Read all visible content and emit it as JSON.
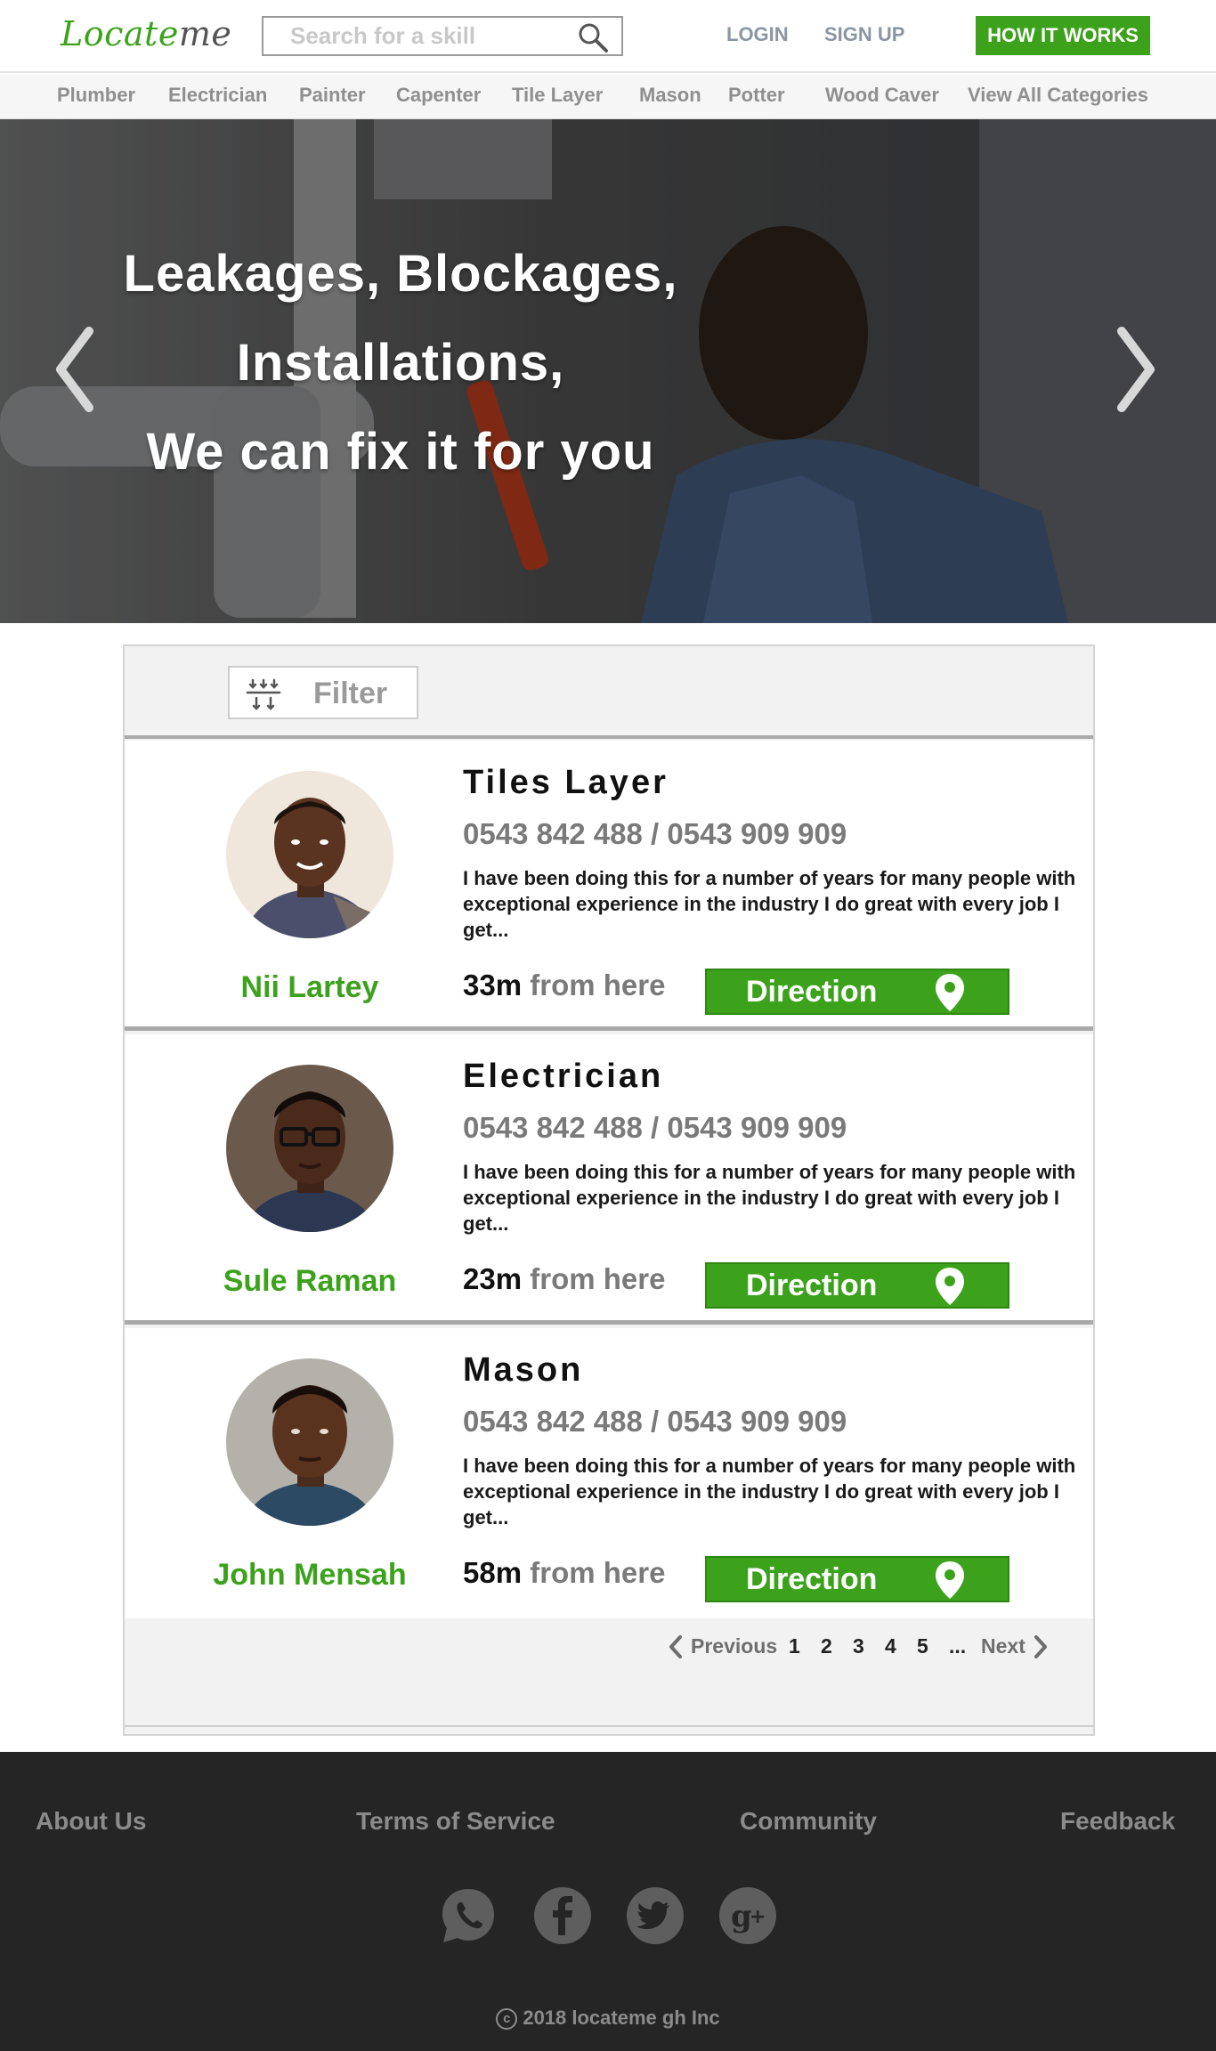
{
  "header": {
    "logo_main": "Locate",
    "logo_accent": "me",
    "search_placeholder": "Search for a skill",
    "login_label": "LOGIN",
    "signup_label": "SIGN UP",
    "how_it_works_label": "HOW IT WORKS"
  },
  "categories": [
    {
      "label": "Plumber"
    },
    {
      "label": "Electrician"
    },
    {
      "label": "Painter"
    },
    {
      "label": "Capenter"
    },
    {
      "label": "Tile Layer"
    },
    {
      "label": "Mason"
    },
    {
      "label": "Potter"
    },
    {
      "label": "Wood Caver"
    },
    {
      "label": "View All Categories"
    }
  ],
  "hero": {
    "line1": "Leakages, Blockages,",
    "line2": "Installations,",
    "line3": "We can fix it for you"
  },
  "filter": {
    "label": "Filter"
  },
  "workers": [
    {
      "name": "Nii Lartey",
      "profession": "Tiles Layer",
      "phones": "0543 842 488 / 0543 909 909",
      "description": "I have been doing this for a number of years for many people with exceptional experience  in the industry I do great with every job I get...",
      "distance": "33m",
      "distance_suffix": "from here",
      "direction_label": "Direction"
    },
    {
      "name": "Sule Raman",
      "profession": "Electrician",
      "phones": "0543 842 488 / 0543 909 909",
      "description": "I have been doing this for a number of years for many people with exceptional experience  in the industry I do great with every job I get...",
      "distance": "23m",
      "distance_suffix": "from here",
      "direction_label": "Direction"
    },
    {
      "name": "John Mensah",
      "profession": "Mason",
      "phones": "0543 842 488 / 0543 909 909",
      "description": "I have been doing this for a number of years for many people with exceptional experience  in the industry I do great with every job I get...",
      "distance": "58m",
      "distance_suffix": "from here",
      "direction_label": "Direction"
    }
  ],
  "pagination": {
    "previous": "Previous",
    "pages": [
      "1",
      "2",
      "3",
      "4",
      "5"
    ],
    "ellipsis": "...",
    "next": "Next"
  },
  "footer": {
    "links": [
      {
        "label": "About Us"
      },
      {
        "label": "Terms of Service"
      },
      {
        "label": "Community"
      },
      {
        "label": "Feedback"
      }
    ],
    "social_icons": [
      "whatsapp-icon",
      "facebook-icon",
      "twitter-icon",
      "google-plus-icon"
    ],
    "copyright": "2018 locateme gh Inc"
  },
  "colors": {
    "brand_green": "#3ca21c",
    "footer_bg": "#252525",
    "muted_text": "#8f8f8f"
  }
}
